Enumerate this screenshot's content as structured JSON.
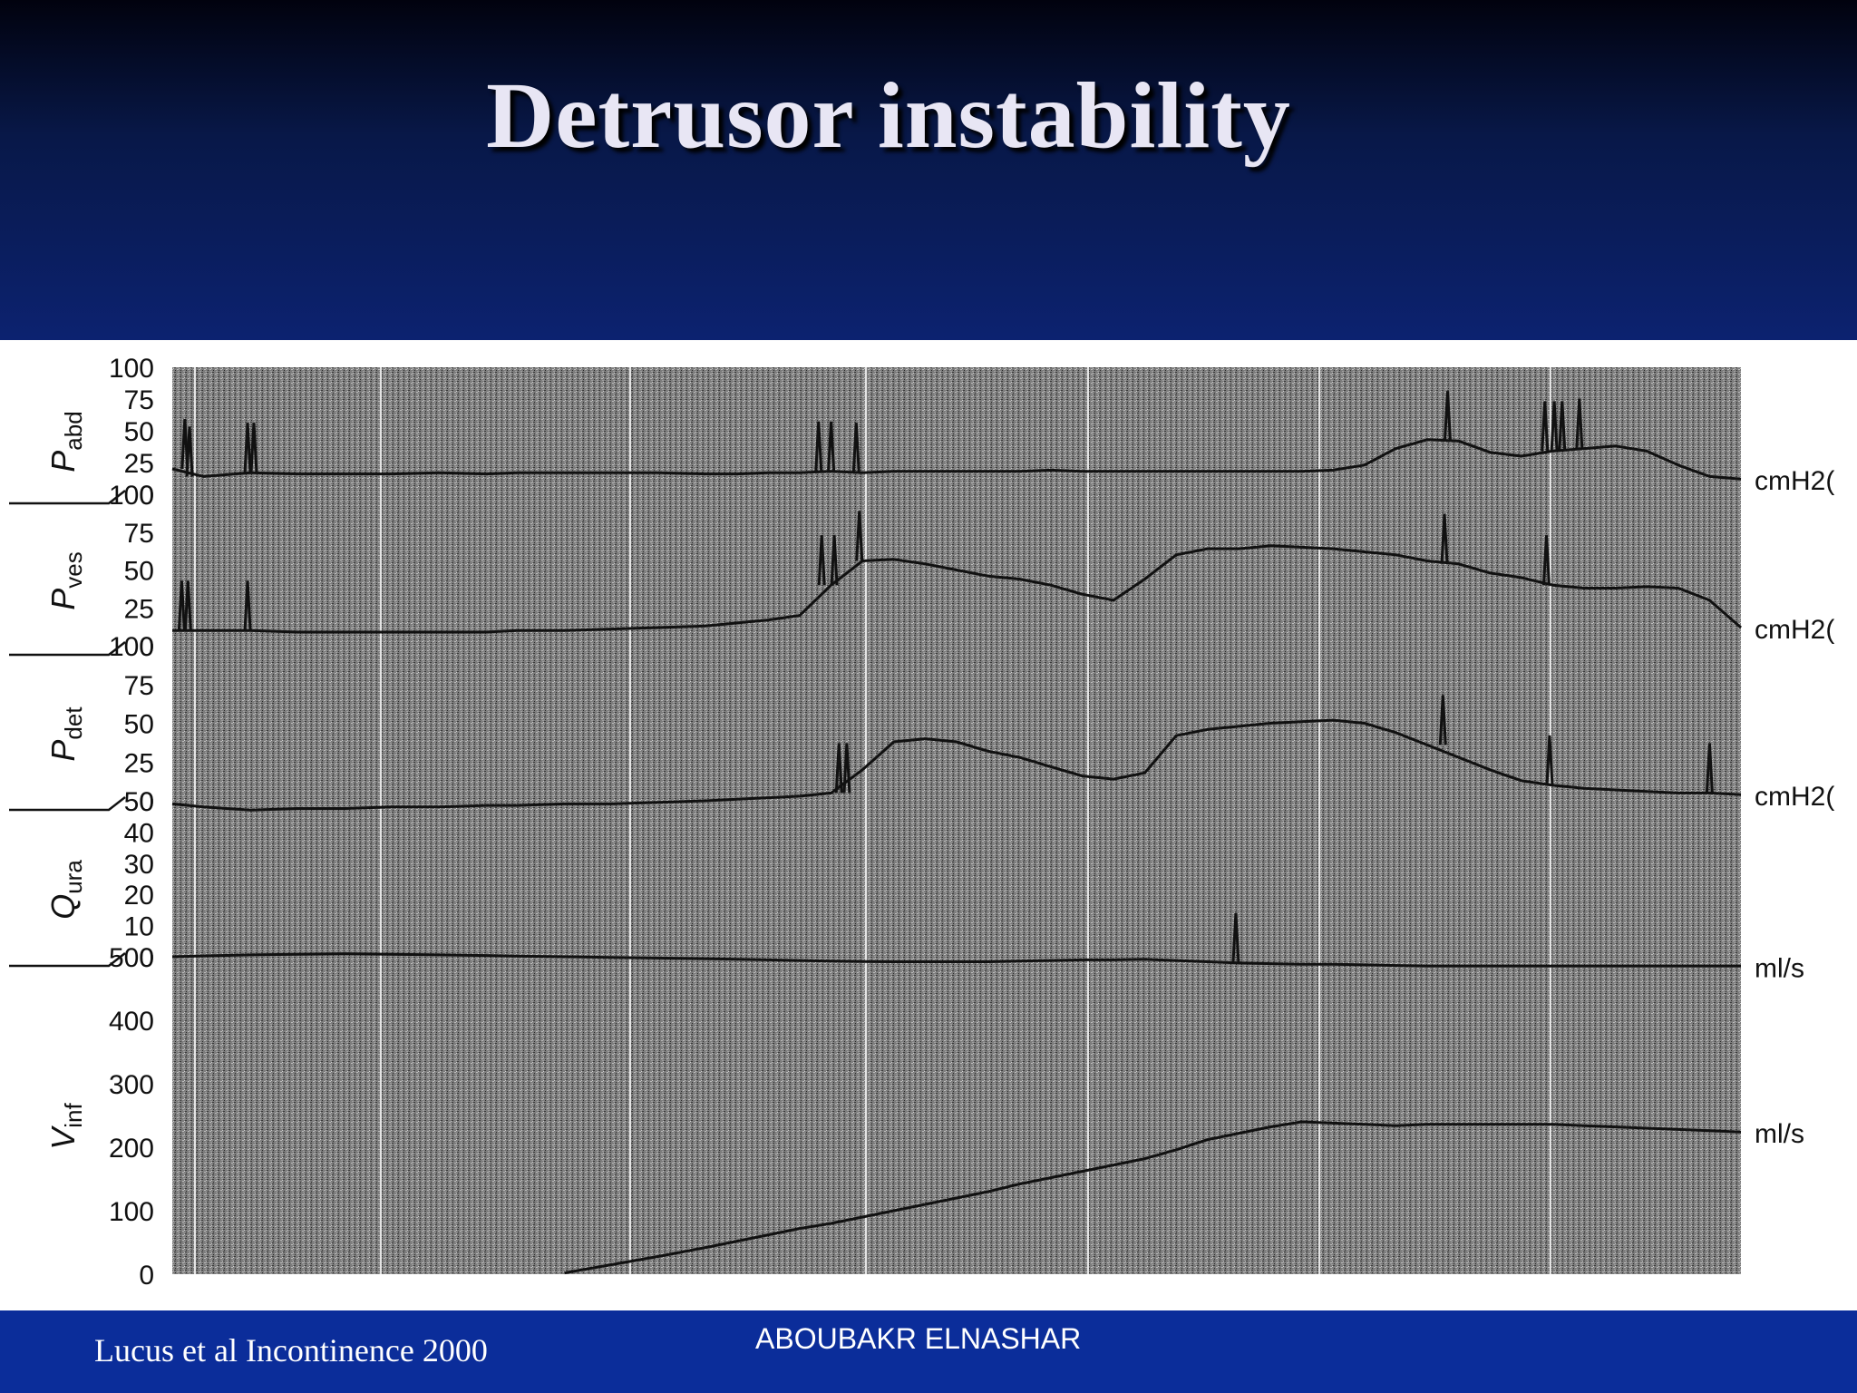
{
  "slide": {
    "title": "Detrusor instability",
    "citation": "Lucus et al  Incontinence 2000",
    "author": "ABOUBAKR ELNASHAR"
  },
  "colors": {
    "header_top": "#01020e",
    "header_bottom": "#0c2270",
    "footer": "#0b2d9a",
    "trace": "#111111"
  },
  "chart_data": {
    "type": "line",
    "title": "",
    "x": [
      0,
      2,
      5,
      8,
      11,
      14,
      17,
      20,
      22,
      25,
      28,
      31,
      34,
      36,
      38,
      40,
      42,
      44,
      46,
      48,
      50,
      52,
      54,
      56,
      58,
      60,
      62,
      64,
      66,
      68,
      70,
      72,
      74,
      76,
      78,
      80,
      82,
      84,
      86,
      88,
      90,
      92,
      94,
      96,
      98,
      100
    ],
    "panels": [
      {
        "label": "P",
        "subscript": "abd",
        "unit": "cmH2(",
        "ticks": [
          "100",
          "75",
          "50",
          "25",
          "0"
        ],
        "ylim": [
          0,
          100
        ],
        "values": [
          20,
          14,
          17,
          16,
          16,
          16,
          17,
          16,
          17,
          17,
          17,
          17,
          16,
          16,
          17,
          17,
          18,
          17,
          18,
          18,
          18,
          18,
          18,
          19,
          18,
          18,
          18,
          18,
          18,
          18,
          18,
          18,
          19,
          23,
          36,
          43,
          42,
          33,
          30,
          34,
          36,
          38,
          34,
          23,
          14,
          12
        ]
      },
      {
        "label": "P",
        "subscript": "ves",
        "unit": "cmH2(",
        "ticks": [
          "100",
          "75",
          "50",
          "25",
          "0"
        ],
        "ylim": [
          0,
          100
        ],
        "values": [
          10,
          10,
          10,
          9,
          9,
          9,
          9,
          9,
          10,
          10,
          11,
          12,
          13,
          15,
          17,
          20,
          40,
          56,
          57,
          54,
          50,
          46,
          44,
          40,
          34,
          30,
          44,
          60,
          64,
          64,
          66,
          65,
          64,
          62,
          60,
          56,
          54,
          48,
          45,
          40,
          38,
          38,
          39,
          38,
          30,
          12
        ]
      },
      {
        "label": "P",
        "subscript": "det",
        "unit": "cmH2(",
        "ticks": [
          "100",
          "75",
          "50",
          "25",
          "0"
        ],
        "ylim": [
          0,
          100
        ],
        "values": [
          -2,
          -4,
          -6,
          -5,
          -5,
          -4,
          -4,
          -3,
          -3,
          -2,
          -2,
          -1,
          0,
          1,
          2,
          3,
          5,
          20,
          38,
          40,
          38,
          32,
          28,
          22,
          16,
          14,
          18,
          42,
          46,
          48,
          50,
          51,
          52,
          50,
          44,
          36,
          28,
          20,
          13,
          10,
          8,
          7,
          6,
          5,
          5,
          4
        ]
      },
      {
        "label": "Q",
        "subscript": "ura",
        "unit": "ml/s",
        "ticks": [
          "50",
          "40",
          "30",
          "20",
          "10",
          "0"
        ],
        "ylim": [
          0,
          50
        ],
        "values": [
          0,
          0.3,
          0.6,
          0.8,
          1,
          0.8,
          0.6,
          0.4,
          0.2,
          0,
          -0.2,
          -0.4,
          -0.6,
          -0.8,
          -1,
          -1.2,
          -1.4,
          -1.5,
          -1.6,
          -1.6,
          -1.6,
          -1.6,
          -1.4,
          -1.2,
          -1,
          -1,
          -0.8,
          -1.2,
          -1.6,
          -2,
          -2.2,
          -2.4,
          -2.4,
          -2.6,
          -2.8,
          -3,
          -3,
          -3,
          -3,
          -3,
          -3,
          -3,
          -3,
          -3,
          -3,
          -3
        ]
      },
      {
        "label": "V",
        "subscript": "inf",
        "unit": "ml/s",
        "ticks": [
          "500",
          "400",
          "300",
          "200",
          "100",
          "0"
        ],
        "ylim": [
          0,
          500
        ],
        "values": [
          null,
          null,
          null,
          null,
          null,
          null,
          null,
          null,
          null,
          2,
          15,
          28,
          42,
          52,
          62,
          72,
          80,
          90,
          100,
          110,
          120,
          130,
          142,
          152,
          162,
          172,
          182,
          196,
          212,
          222,
          232,
          240,
          238,
          236,
          234,
          236,
          236,
          236,
          236,
          236,
          234,
          232,
          230,
          228,
          226,
          224
        ]
      }
    ],
    "spikes": [
      {
        "panel": 0,
        "x": [
          0.8,
          1.1,
          4.8,
          5.2,
          41.2,
          42.0,
          43.6,
          81.3,
          87.5,
          88.1,
          88.6,
          89.7
        ]
      },
      {
        "panel": 1,
        "x": [
          0.6,
          1.0,
          4.8,
          41.4,
          42.2,
          43.8,
          81.1,
          87.6
        ]
      },
      {
        "panel": 2,
        "x": [
          42.5,
          43.0,
          81.0,
          87.8,
          98.0
        ]
      },
      {
        "panel": 3,
        "x": [
          67.8
        ]
      }
    ]
  }
}
